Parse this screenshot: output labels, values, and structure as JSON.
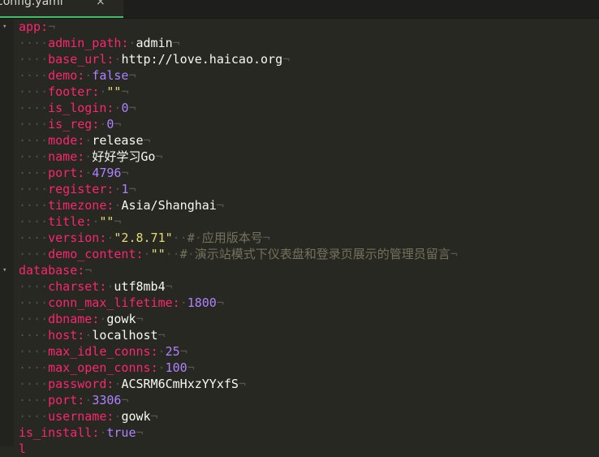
{
  "tab": {
    "label": "config.yaml",
    "close": "×"
  },
  "lines": [
    {
      "indent": 0,
      "key": "app",
      "fold": true
    },
    {
      "indent": 1,
      "key": "admin_path",
      "value": "admin",
      "vtype": "plain"
    },
    {
      "indent": 1,
      "key": "base_url",
      "value": "http://love.haicao.org",
      "vtype": "plain"
    },
    {
      "indent": 1,
      "key": "demo",
      "value": "false",
      "vtype": "const"
    },
    {
      "indent": 1,
      "key": "footer",
      "value": "\"\"",
      "vtype": "string"
    },
    {
      "indent": 1,
      "key": "is_login",
      "value": "0",
      "vtype": "const"
    },
    {
      "indent": 1,
      "key": "is_reg",
      "value": "0",
      "vtype": "const"
    },
    {
      "indent": 1,
      "key": "mode",
      "value": "release",
      "vtype": "plain"
    },
    {
      "indent": 1,
      "key": "name",
      "value": "好好学习Go",
      "vtype": "plain"
    },
    {
      "indent": 1,
      "key": "port",
      "value": "4796",
      "vtype": "const"
    },
    {
      "indent": 1,
      "key": "register",
      "value": "1",
      "vtype": "const"
    },
    {
      "indent": 1,
      "key": "timezone",
      "value": "Asia/Shanghai",
      "vtype": "plain"
    },
    {
      "indent": 1,
      "key": "title",
      "value": "\"\"",
      "vtype": "string"
    },
    {
      "indent": 1,
      "key": "version",
      "value": "\"2.8.71\"",
      "vtype": "string",
      "comment": "应用版本号"
    },
    {
      "indent": 1,
      "key": "demo_content",
      "value": "\"\"",
      "vtype": "string",
      "comment": "演示站模式下仪表盘和登录页展示的管理员留言"
    },
    {
      "indent": 0,
      "key": "database",
      "fold": true
    },
    {
      "indent": 1,
      "key": "charset",
      "value": "utf8mb4",
      "vtype": "plain"
    },
    {
      "indent": 1,
      "key": "conn_max_lifetime",
      "value": "1800",
      "vtype": "const"
    },
    {
      "indent": 1,
      "key": "dbname",
      "value": "gowk",
      "vtype": "plain"
    },
    {
      "indent": 1,
      "key": "host",
      "value": "localhost",
      "vtype": "plain"
    },
    {
      "indent": 1,
      "key": "max_idle_conns",
      "value": "25",
      "vtype": "const"
    },
    {
      "indent": 1,
      "key": "max_open_conns",
      "value": "100",
      "vtype": "const"
    },
    {
      "indent": 1,
      "key": "password",
      "value": "ACSRM6CmHxzYYxfS",
      "vtype": "plain"
    },
    {
      "indent": 1,
      "key": "port",
      "value": "3306",
      "vtype": "const"
    },
    {
      "indent": 1,
      "key": "username",
      "value": "gowk",
      "vtype": "plain"
    },
    {
      "indent": 0,
      "key": "is_install",
      "value": "true",
      "vtype": "const"
    },
    {
      "indent": 0,
      "key": "l",
      "partial": true
    }
  ],
  "colors": {
    "background": "#272822",
    "key": "#f92672",
    "constant": "#ae81ff",
    "string": "#e6db74",
    "comment": "#75715e",
    "whitespace": "#4f5149",
    "tab_accent": "#3fbf6a"
  }
}
